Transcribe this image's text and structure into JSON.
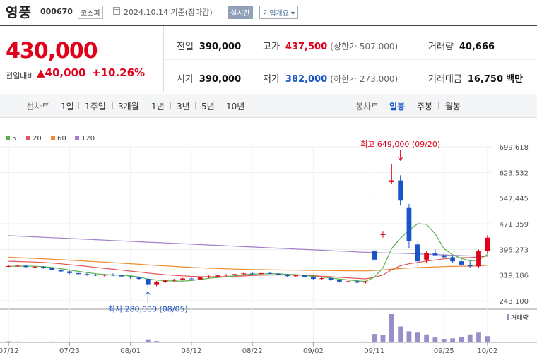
{
  "header": {
    "name": "영풍",
    "code": "000670",
    "market": "코스피",
    "date": "2024.10.14 기준(장마감)",
    "live_label": "실시간",
    "info_label": "기업개요"
  },
  "price": {
    "current": "430,000",
    "change_label": "전일대비",
    "change": "40,000",
    "change_pct": "+10.26%"
  },
  "stats": {
    "prev_close": {
      "label": "전일",
      "value": "390,000"
    },
    "open": {
      "label": "시가",
      "value": "390,000"
    },
    "high": {
      "label": "고가",
      "value": "437,500",
      "limit": "(상한가 507,000)"
    },
    "low": {
      "label": "저가",
      "value": "382,000",
      "limit": "(하한가 273,000)"
    },
    "volume": {
      "label": "거래량",
      "value": "40,666"
    },
    "amount": {
      "label": "거래대금",
      "value": "16,750",
      "unit": "백만"
    }
  },
  "toolbar": {
    "line_label": "선차트",
    "periods": [
      "1일",
      "1주일",
      "3개월",
      "1년",
      "3년",
      "5년",
      "10년"
    ],
    "candle_label": "봉차트",
    "candle_periods": [
      "일봉",
      "주봉",
      "월봉"
    ],
    "selected": "일봉"
  },
  "colors": {
    "up": "#e0001a",
    "down": "#1a55c8",
    "ma5": "#56b34a",
    "ma20": "#e05555",
    "ma60": "#f08a2c",
    "ma120": "#a07fc8"
  },
  "chart_data": {
    "type": "candlestick",
    "legend": [
      {
        "name": "5",
        "color": "#56b34a"
      },
      {
        "name": "20",
        "color": "#e05555"
      },
      {
        "name": "60",
        "color": "#f08a2c"
      },
      {
        "name": "120",
        "color": "#a07fc8"
      }
    ],
    "y_ticks": [
      "699,618",
      "623,532",
      "547,445",
      "471,359",
      "395,273",
      "319,186",
      "243,100"
    ],
    "y_range": [
      243100,
      699618
    ],
    "x_ticks": [
      "07/12",
      "07/23",
      "08/01",
      "08/12",
      "08/22",
      "09/02",
      "09/11",
      "09/25",
      "10/02"
    ],
    "x_tick_index": [
      0,
      7,
      14,
      21,
      28,
      35,
      42,
      50,
      55
    ],
    "high_annotation": "최고 649,000 (09/20)",
    "low_annotation": "최저 280,000 (08/05)",
    "high_index": 45,
    "high_value": 649000,
    "low_index": 16,
    "low_value": 280000,
    "volume_label": "거래량",
    "candles": [
      [
        345000,
        348000,
        343000,
        346000
      ],
      [
        346000,
        350000,
        344000,
        347000
      ],
      [
        347000,
        349000,
        342000,
        343000
      ],
      [
        343000,
        346000,
        340000,
        344000
      ],
      [
        344000,
        345000,
        338000,
        340000
      ],
      [
        340000,
        342000,
        333000,
        335000
      ],
      [
        335000,
        337000,
        328000,
        330000
      ],
      [
        330000,
        332000,
        322000,
        325000
      ],
      [
        325000,
        328000,
        318000,
        322000
      ],
      [
        322000,
        325000,
        317000,
        320000
      ],
      [
        320000,
        323000,
        316000,
        318000
      ],
      [
        318000,
        322000,
        315000,
        320000
      ],
      [
        320000,
        324000,
        316000,
        318000
      ],
      [
        318000,
        320000,
        312000,
        315000
      ],
      [
        315000,
        318000,
        308000,
        312000
      ],
      [
        312000,
        314000,
        304000,
        308000
      ],
      [
        308000,
        310000,
        280000,
        290000
      ],
      [
        290000,
        302000,
        286000,
        299000
      ],
      [
        299000,
        305000,
        295000,
        303000
      ],
      [
        303000,
        308000,
        300000,
        306000
      ],
      [
        306000,
        311000,
        303000,
        309000
      ],
      [
        309000,
        313000,
        305000,
        307000
      ],
      [
        307000,
        314000,
        305000,
        312000
      ],
      [
        312000,
        318000,
        310000,
        315000
      ],
      [
        315000,
        320000,
        312000,
        318000
      ],
      [
        318000,
        322000,
        315000,
        320000
      ],
      [
        320000,
        325000,
        316000,
        322000
      ],
      [
        322000,
        326000,
        319000,
        324000
      ],
      [
        324000,
        328000,
        320000,
        322000
      ],
      [
        322000,
        327000,
        320000,
        325000
      ],
      [
        325000,
        329000,
        322000,
        323000
      ],
      [
        323000,
        325000,
        318000,
        320000
      ],
      [
        320000,
        322000,
        314000,
        316000
      ],
      [
        316000,
        320000,
        313000,
        318000
      ],
      [
        318000,
        320000,
        312000,
        314000
      ],
      [
        314000,
        316000,
        306000,
        308000
      ],
      [
        308000,
        312000,
        304000,
        310000
      ],
      [
        310000,
        312000,
        302000,
        304000
      ],
      [
        304000,
        306000,
        297000,
        300000
      ],
      [
        300000,
        304000,
        296000,
        301000
      ],
      [
        301000,
        303000,
        295000,
        297000
      ],
      [
        297000,
        302000,
        294000,
        300000
      ],
      [
        390000,
        395000,
        360000,
        365000
      ],
      [
        440000,
        450000,
        430000,
        440000
      ],
      [
        595000,
        649000,
        590000,
        600000
      ],
      [
        600000,
        615000,
        525000,
        540000
      ],
      [
        520000,
        530000,
        400000,
        420000
      ],
      [
        410000,
        420000,
        345000,
        360000
      ],
      [
        365000,
        390000,
        355000,
        385000
      ],
      [
        385000,
        395000,
        375000,
        378000
      ],
      [
        378000,
        385000,
        368000,
        372000
      ],
      [
        372000,
        378000,
        355000,
        360000
      ],
      [
        360000,
        370000,
        345000,
        350000
      ],
      [
        350000,
        360000,
        340000,
        345000
      ],
      [
        345000,
        395000,
        342000,
        390000
      ],
      [
        390000,
        437500,
        382000,
        430000
      ]
    ],
    "volumes": [
      1200,
      900,
      800,
      700,
      600,
      900,
      800,
      700,
      650,
      600,
      550,
      500,
      600,
      650,
      700,
      700,
      3500,
      1500,
      800,
      700,
      600,
      650,
      600,
      700,
      650,
      600,
      600,
      650,
      600,
      650,
      600,
      650,
      700,
      600,
      650,
      700,
      650,
      600,
      600,
      650,
      700,
      900,
      9500,
      8200,
      32000,
      18000,
      12500,
      11000,
      9000,
      5500,
      4000,
      4500,
      5800,
      9000,
      11000,
      7000
    ],
    "ma5": [
      345000,
      345800,
      345500,
      345200,
      344000,
      341800,
      338400,
      334200,
      330200,
      326600,
      323000,
      321000,
      319600,
      318600,
      316600,
      313600,
      307200,
      304600,
      302600,
      301600,
      301400,
      303000,
      306200,
      309400,
      311800,
      314000,
      317200,
      319800,
      322200,
      322600,
      323200,
      323400,
      321400,
      320400,
      318200,
      315200,
      313200,
      310800,
      307200,
      304600,
      302400,
      300400,
      312600,
      340400,
      397800,
      428000,
      452000,
      471600,
      469400,
      441600,
      398000,
      379200,
      369000,
      361000,
      363400,
      380200
    ],
    "ma20": [
      360000,
      359400,
      358600,
      357600,
      356400,
      354800,
      352600,
      350000,
      347400,
      344800,
      342000,
      339200,
      336400,
      333800,
      331000,
      328400,
      325200,
      322400,
      320200,
      318400,
      316800,
      315400,
      314600,
      314200,
      314400,
      314800,
      315600,
      316600,
      317800,
      318600,
      319400,
      319800,
      319600,
      319200,
      318400,
      317200,
      315800,
      314400,
      312600,
      311000,
      309400,
      308000,
      312600,
      319400,
      334800,
      346800,
      352600,
      356600,
      360600,
      364000,
      367000,
      369400,
      370600,
      371000,
      372200,
      376800
    ],
    "ma60": [
      372000,
      370900,
      369800,
      368600,
      367400,
      366100,
      364800,
      363400,
      361900,
      360400,
      358900,
      357400,
      355900,
      354400,
      352800,
      351200,
      349500,
      347900,
      346300,
      344800,
      343400,
      342000,
      340800,
      339700,
      338700,
      337800,
      337000,
      336300,
      335700,
      335200,
      334800,
      334400,
      334000,
      333700,
      333400,
      333100,
      332800,
      332500,
      332200,
      331900,
      331600,
      331400,
      332800,
      334500,
      336700,
      338600,
      340100,
      341300,
      342400,
      343400,
      344200,
      344800,
      345300,
      345700,
      346600,
      348200
    ],
    "ma120": [
      436000,
      434800,
      433600,
      432400,
      431200,
      430000,
      428800,
      427600,
      426400,
      425200,
      424000,
      422800,
      421600,
      420400,
      419200,
      418000,
      416800,
      415600,
      414400,
      413200,
      412000,
      410800,
      409600,
      408400,
      407200,
      406000,
      404800,
      403600,
      402400,
      401200,
      400000,
      398800,
      397600,
      396400,
      395200,
      394000,
      392800,
      391600,
      390400,
      389200,
      388000,
      386800,
      385800,
      385000,
      384400,
      383800,
      383000,
      382000,
      381000,
      380000,
      379000,
      378000,
      377000,
      376000,
      375500,
      375200
    ]
  }
}
